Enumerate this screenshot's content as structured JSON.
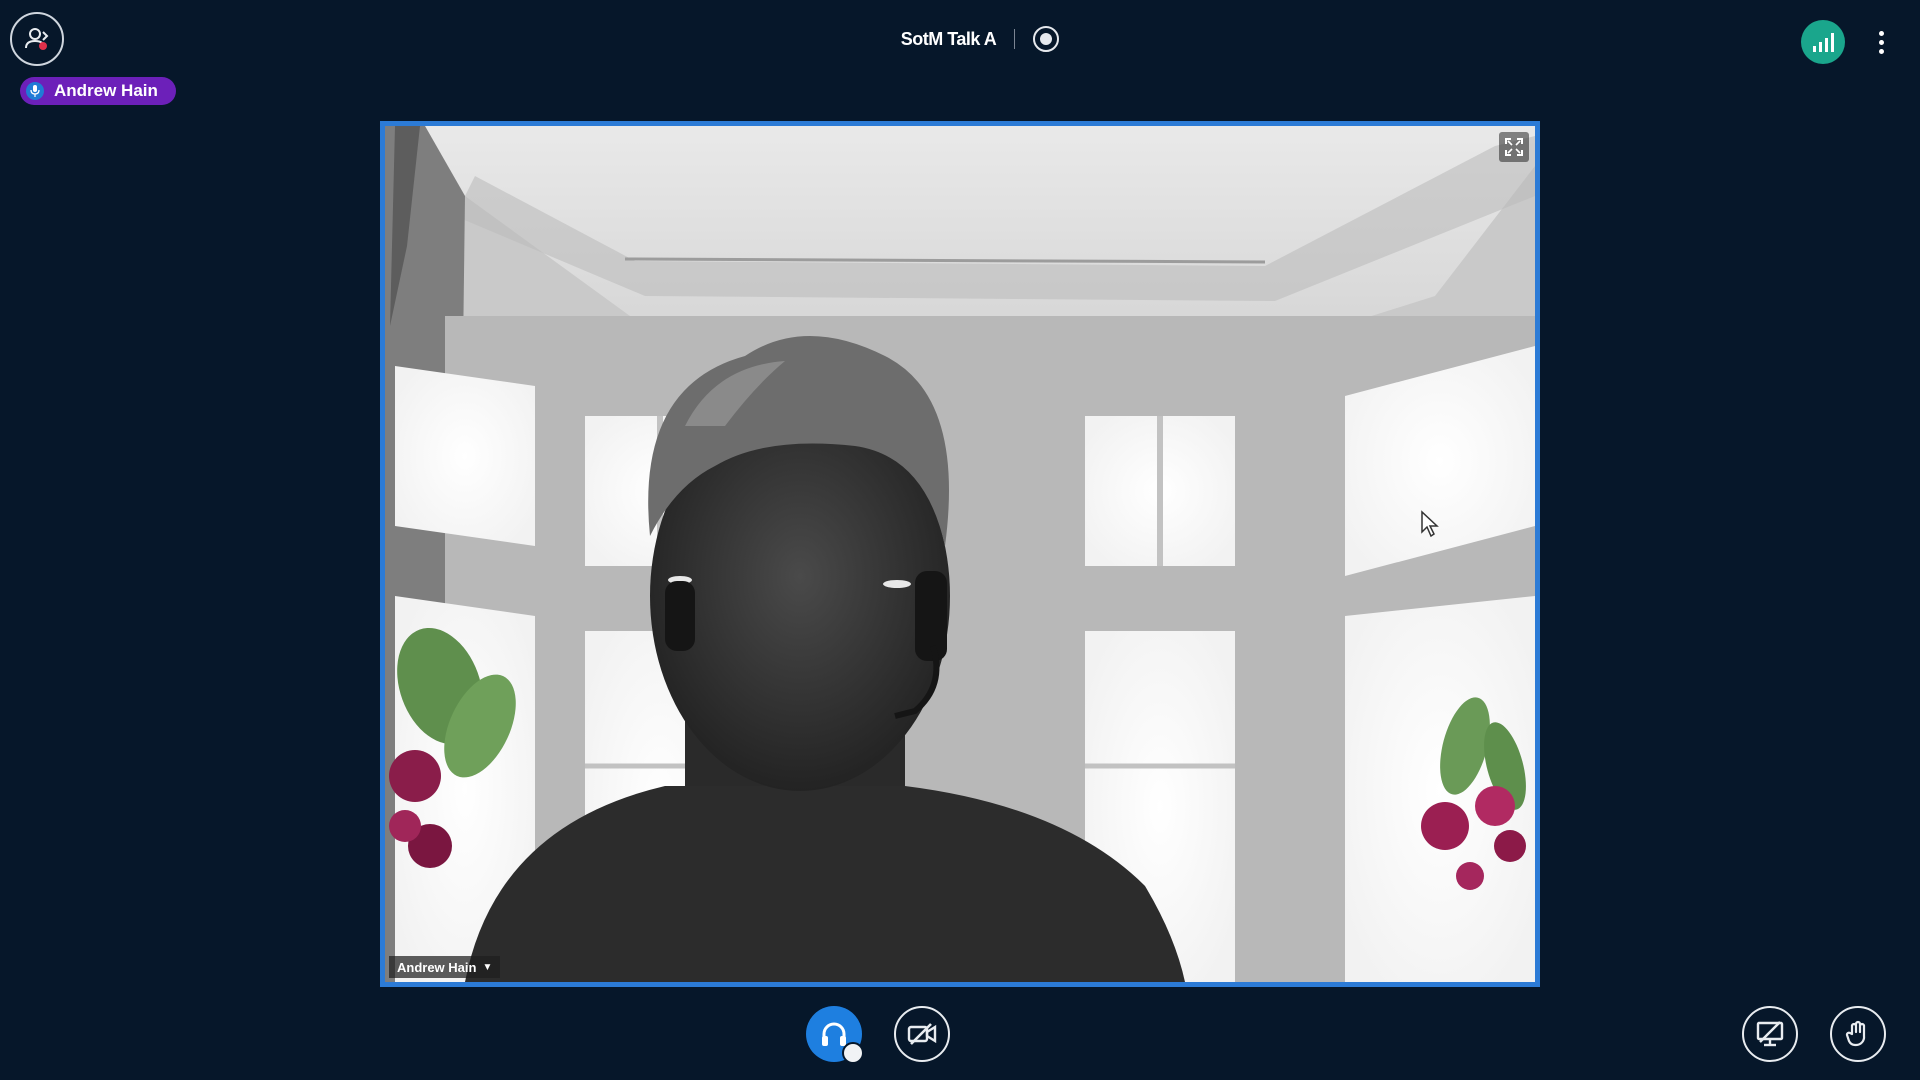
{
  "header": {
    "meeting_title": "SotM Talk A",
    "talking_user": "Andrew Hain"
  },
  "video": {
    "participant_name": "Andrew Hain"
  },
  "colors": {
    "background": "#06172a",
    "video_border": "#2c7bd6",
    "talker_pill": "#6c20b9",
    "connection": "#1aa68c",
    "audio_active": "#1e7fe0"
  },
  "icons": {
    "users_toggle": "users-icon",
    "record": "record-icon",
    "connection": "signal-bars-icon",
    "options": "more-vertical-icon",
    "fullscreen": "fullscreen-icon",
    "audio": "headphones-icon",
    "video": "video-off-icon",
    "share": "screenshare-off-icon",
    "raise_hand": "hand-icon"
  }
}
